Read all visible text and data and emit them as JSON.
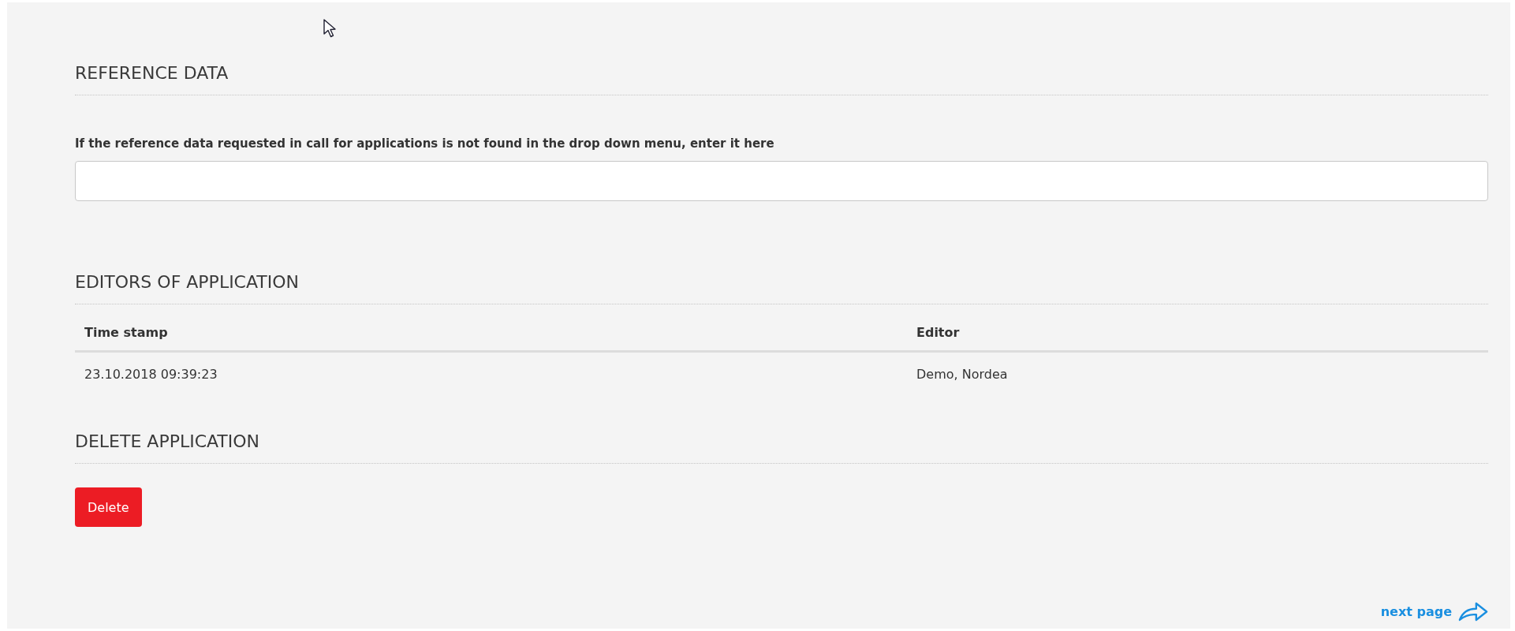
{
  "sections": [
    {
      "kind": "field",
      "heading": "REFERENCE DATA",
      "label": "If the reference data requested in call for applications is not found in the drop down menu, enter it here"
    },
    {
      "kind": "table",
      "heading": "EDITORS OF APPLICATION",
      "columns": [
        "Time stamp",
        "Editor"
      ],
      "rows": [
        [
          "23.10.2018 09:39:23",
          "Demo, Nordea"
        ]
      ]
    },
    {
      "kind": "action",
      "heading": "DELETE APPLICATION",
      "button": "Delete"
    }
  ],
  "next_link": "next page"
}
